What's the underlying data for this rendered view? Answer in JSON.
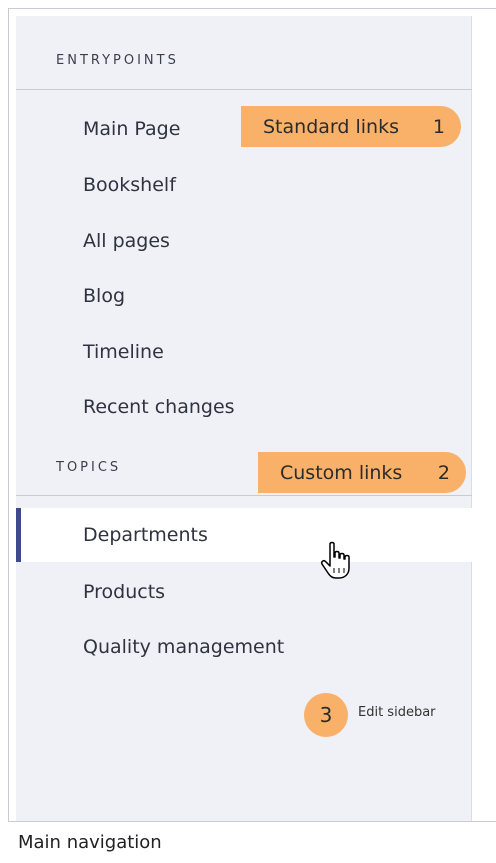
{
  "sidebar": {
    "entrypoints_heading": "ENTRYPOINTS",
    "entrypoints": [
      {
        "label": "Main Page"
      },
      {
        "label": "Bookshelf"
      },
      {
        "label": "All pages"
      },
      {
        "label": "Blog"
      },
      {
        "label": "Timeline"
      },
      {
        "label": "Recent changes"
      }
    ],
    "topics_heading": "TOPICS",
    "topics": [
      {
        "label": "Departments",
        "active": true
      },
      {
        "label": "Products"
      },
      {
        "label": "Quality management"
      }
    ],
    "edit_label": "Edit sidebar",
    "active_accent_color": "#3e4a8c"
  },
  "annotations": {
    "standard": {
      "label": "Standard links",
      "number": "1"
    },
    "custom": {
      "label": "Custom links",
      "number": "2"
    },
    "edit": {
      "number": "3"
    },
    "color": "#f9b068"
  },
  "caption": "Main navigation",
  "cursor": "hand-pointer-icon"
}
